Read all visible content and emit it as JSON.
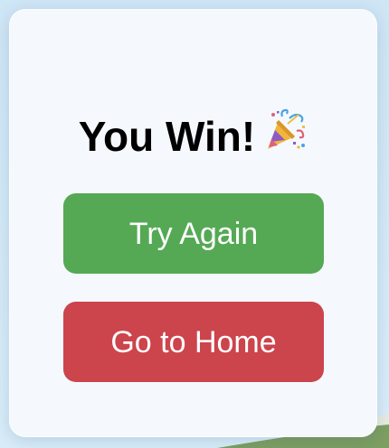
{
  "dialog": {
    "title": "You Win!",
    "title_icon": "party-popper-icon",
    "try_again_label": "Try Again",
    "go_home_label": "Go to Home"
  },
  "colors": {
    "card_background": "#f5f9fd",
    "try_again": "#55a955",
    "go_home": "#cc444c",
    "text_on_buttons": "#ffffff"
  }
}
